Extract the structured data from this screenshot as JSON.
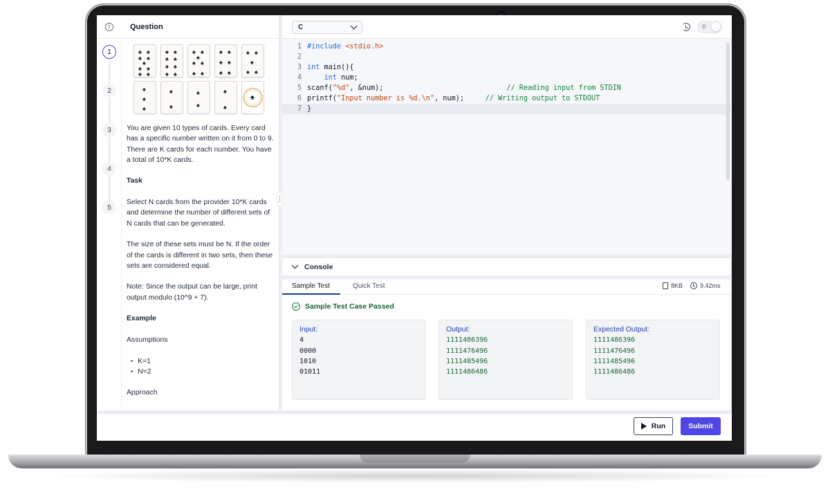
{
  "question": {
    "title": "Question",
    "steps": [
      "1",
      "2",
      "3",
      "4",
      "5"
    ],
    "intro": "You are given 10 types of cards. Every card has a specific number written on it from 0 to 9. There are K cards for each number. You have a total of 10*K cards.",
    "task_heading": "Task",
    "task_text": "Select N cards from the provider 10*K cards and determine the number of different sets of N cards that can be generated.",
    "size_text": "The size of these sets must be N. If the order of the cards is different in two sets, then these sets are considered equal.",
    "note_text": "Note: Since the output can be large, print output modulo (10^9 + 7).",
    "example_heading": "Example",
    "assumptions_heading": "Assumptions",
    "assumptions": [
      "K=1",
      "N=2"
    ],
    "approach_heading": "Approach"
  },
  "editor": {
    "language": "C",
    "lines": [
      {
        "num": "1"
      },
      {
        "num": "2"
      },
      {
        "num": "3"
      },
      {
        "num": "4"
      },
      {
        "num": "5"
      },
      {
        "num": "6"
      },
      {
        "num": "7"
      }
    ],
    "code": {
      "include": "#include",
      "header": "<stdio.h>",
      "int1": "int",
      "main": " main(){",
      "int2": "int",
      "num_decl": " num;",
      "scanf": "scanf(",
      "scanf_fmt": "\"%d\"",
      "scanf_rest": ", &num);",
      "scanf_comment": "// Reading input from STDIN",
      "printf": "printf(",
      "printf_fmt": "\"Input number is %d.\\n\"",
      "printf_rest": ", num);",
      "printf_comment": "// Writing output to STDOUT",
      "close": "}"
    }
  },
  "console": {
    "label": "Console",
    "tabs": [
      "Sample Test",
      "Quick Test"
    ],
    "memory": "8KB",
    "time": "9.42ms",
    "status": "Sample Test Case Passed",
    "input": {
      "label": "Input:",
      "values": [
        "4",
        "0000",
        "1010",
        "01011"
      ]
    },
    "output": {
      "label": "Output:",
      "values": [
        "1111486396",
        "1111476496",
        "1111485496",
        "1111486486"
      ]
    },
    "expected": {
      "label": "Expected Output:",
      "values": [
        "1111486396",
        "1111476496",
        "1111485496",
        "1111486486"
      ]
    }
  },
  "actions": {
    "run": "Run",
    "submit": "Submit"
  },
  "colors": {
    "accent": "#4f46e5",
    "pass": "#166534",
    "keyword": "#2563eb",
    "string": "#c2410c",
    "comment": "#15803d"
  }
}
